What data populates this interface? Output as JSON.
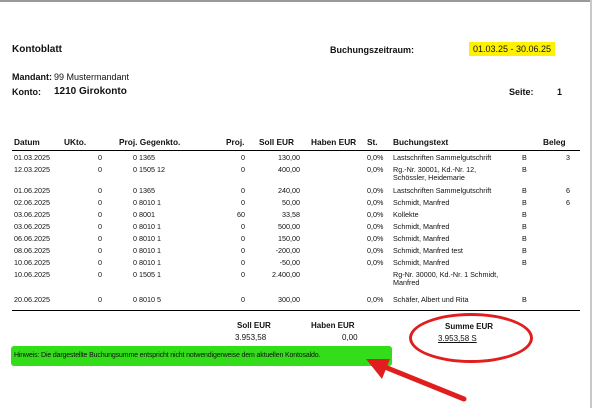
{
  "header": {
    "title": "Kontoblatt",
    "period_label": "Buchungszeitraum:",
    "period_value": "01.03.25 - 30.06.25",
    "mandant_label": "Mandant:",
    "mandant_value": "99 Mustermandant",
    "konto_label": "Konto:",
    "konto_value": "1210 Girokonto",
    "seite_label": "Seite:",
    "seite_value": "1"
  },
  "table": {
    "columns": {
      "datum": "Datum",
      "ukto": "UKto.",
      "proj_gegenkto": "Proj. Gegenkto.",
      "proj": "Proj.",
      "soll": "Soll EUR",
      "haben": "Haben EUR",
      "st": "St.",
      "text": "Buchungstext",
      "beleg": "Beleg"
    },
    "rows": [
      {
        "datum": "01.03.2025",
        "ukto": "0",
        "proj_gegenkto": "0  1365",
        "proj": "0",
        "soll": "130,00",
        "haben": "",
        "st": "0,0%",
        "text": "Lastschriften Sammelgutschrift",
        "b": "B",
        "beleg": "3"
      },
      {
        "datum": "12.03.2025",
        "ukto": "0",
        "proj_gegenkto": "0  1505 12",
        "proj": "0",
        "soll": "400,00",
        "haben": "",
        "st": "0,0%",
        "text": "Rg.-Nr. 30001, Kd.-Nr. 12,",
        "text2": "Schössler, Heidemarie",
        "b": "B",
        "beleg": ""
      },
      {
        "datum": "01.06.2025",
        "ukto": "0",
        "proj_gegenkto": "0  1365",
        "proj": "0",
        "soll": "240,00",
        "haben": "",
        "st": "0,0%",
        "text": "Lastschriften Sammelgutschrift",
        "b": "B",
        "beleg": "6"
      },
      {
        "datum": "02.06.2025",
        "ukto": "0",
        "proj_gegenkto": "0  8010 1",
        "proj": "0",
        "soll": "50,00",
        "haben": "",
        "st": "0,0%",
        "text": "Schmidt, Manfred",
        "b": "B",
        "beleg": "6"
      },
      {
        "datum": "03.06.2025",
        "ukto": "0",
        "proj_gegenkto": "0  8001",
        "proj": "60",
        "soll": "33,58",
        "haben": "",
        "st": "0,0%",
        "text": "Kollekte",
        "b": "B",
        "beleg": ""
      },
      {
        "datum": "03.06.2025",
        "ukto": "0",
        "proj_gegenkto": "0  8010 1",
        "proj": "0",
        "soll": "500,00",
        "haben": "",
        "st": "0,0%",
        "text": "Schmidt, Manfred",
        "b": "B",
        "beleg": ""
      },
      {
        "datum": "06.06.2025",
        "ukto": "0",
        "proj_gegenkto": "0  8010 1",
        "proj": "0",
        "soll": "150,00",
        "haben": "",
        "st": "0,0%",
        "text": "Schmidt, Manfred",
        "b": "B",
        "beleg": ""
      },
      {
        "datum": "08.06.2025",
        "ukto": "0",
        "proj_gegenkto": "0  8010 1",
        "proj": "0",
        "soll": "-200,00",
        "haben": "",
        "st": "0,0%",
        "text": "Schmidt, Manfred test",
        "b": "B",
        "beleg": ""
      },
      {
        "datum": "10.06.2025",
        "ukto": "0",
        "proj_gegenkto": "0  8010 1",
        "proj": "0",
        "soll": "-50,00",
        "haben": "",
        "st": "0,0%",
        "text": "Schmidt, Manfred",
        "b": "B",
        "beleg": ""
      },
      {
        "datum": "10.06.2025",
        "ukto": "0",
        "proj_gegenkto": "0  1505 1",
        "proj": "0",
        "soll": "2.400,00",
        "haben": "",
        "st": "",
        "text": "Rg-Nr. 30000, Kd.-Nr. 1 Schmidt,",
        "text2": "Manfred",
        "b": "",
        "beleg": ""
      },
      {
        "datum": "20.06.2025",
        "ukto": "0",
        "proj_gegenkto": "0  8010 5",
        "proj": "0",
        "soll": "300,00",
        "haben": "",
        "st": "0,0%",
        "text": "Schäfer, Albert und Rita",
        "b": "B",
        "beleg": ""
      }
    ]
  },
  "totals": {
    "soll_label": "Soll EUR",
    "soll_value": "3.953,58",
    "haben_label": "Haben EUR",
    "haben_value": "0,00",
    "summe_label": "Summe EUR",
    "summe_value": "3.953,58 S"
  },
  "note": "Hinweis: Die dargestellte Buchungsumme entspricht nicht notwendigerweise dem aktuellen Kontosaldo.",
  "colors": {
    "highlight_yellow": "#fff200",
    "highlight_green": "#33dd1a",
    "annotation_red": "#e11e1e"
  }
}
